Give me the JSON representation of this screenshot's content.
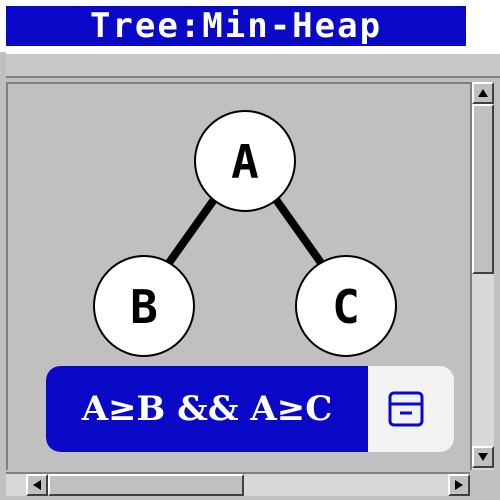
{
  "window": {
    "title": "Tree:Min-Heap",
    "accent_color": "#0a09c7"
  },
  "tree": {
    "nodes": [
      {
        "id": "A",
        "label": "A"
      },
      {
        "id": "B",
        "label": "B"
      },
      {
        "id": "C",
        "label": "C"
      }
    ],
    "edges": [
      [
        "A",
        "B"
      ],
      [
        "A",
        "C"
      ]
    ]
  },
  "banner": {
    "text": "A≥B && A≥C",
    "icon": "archive-icon"
  },
  "scrollbars": {
    "vertical": {
      "up_icon": "arrow-up-icon",
      "down_icon": "arrow-down-icon"
    },
    "horizontal": {
      "left_icon": "arrow-left-icon",
      "right_icon": "arrow-right-icon"
    }
  }
}
